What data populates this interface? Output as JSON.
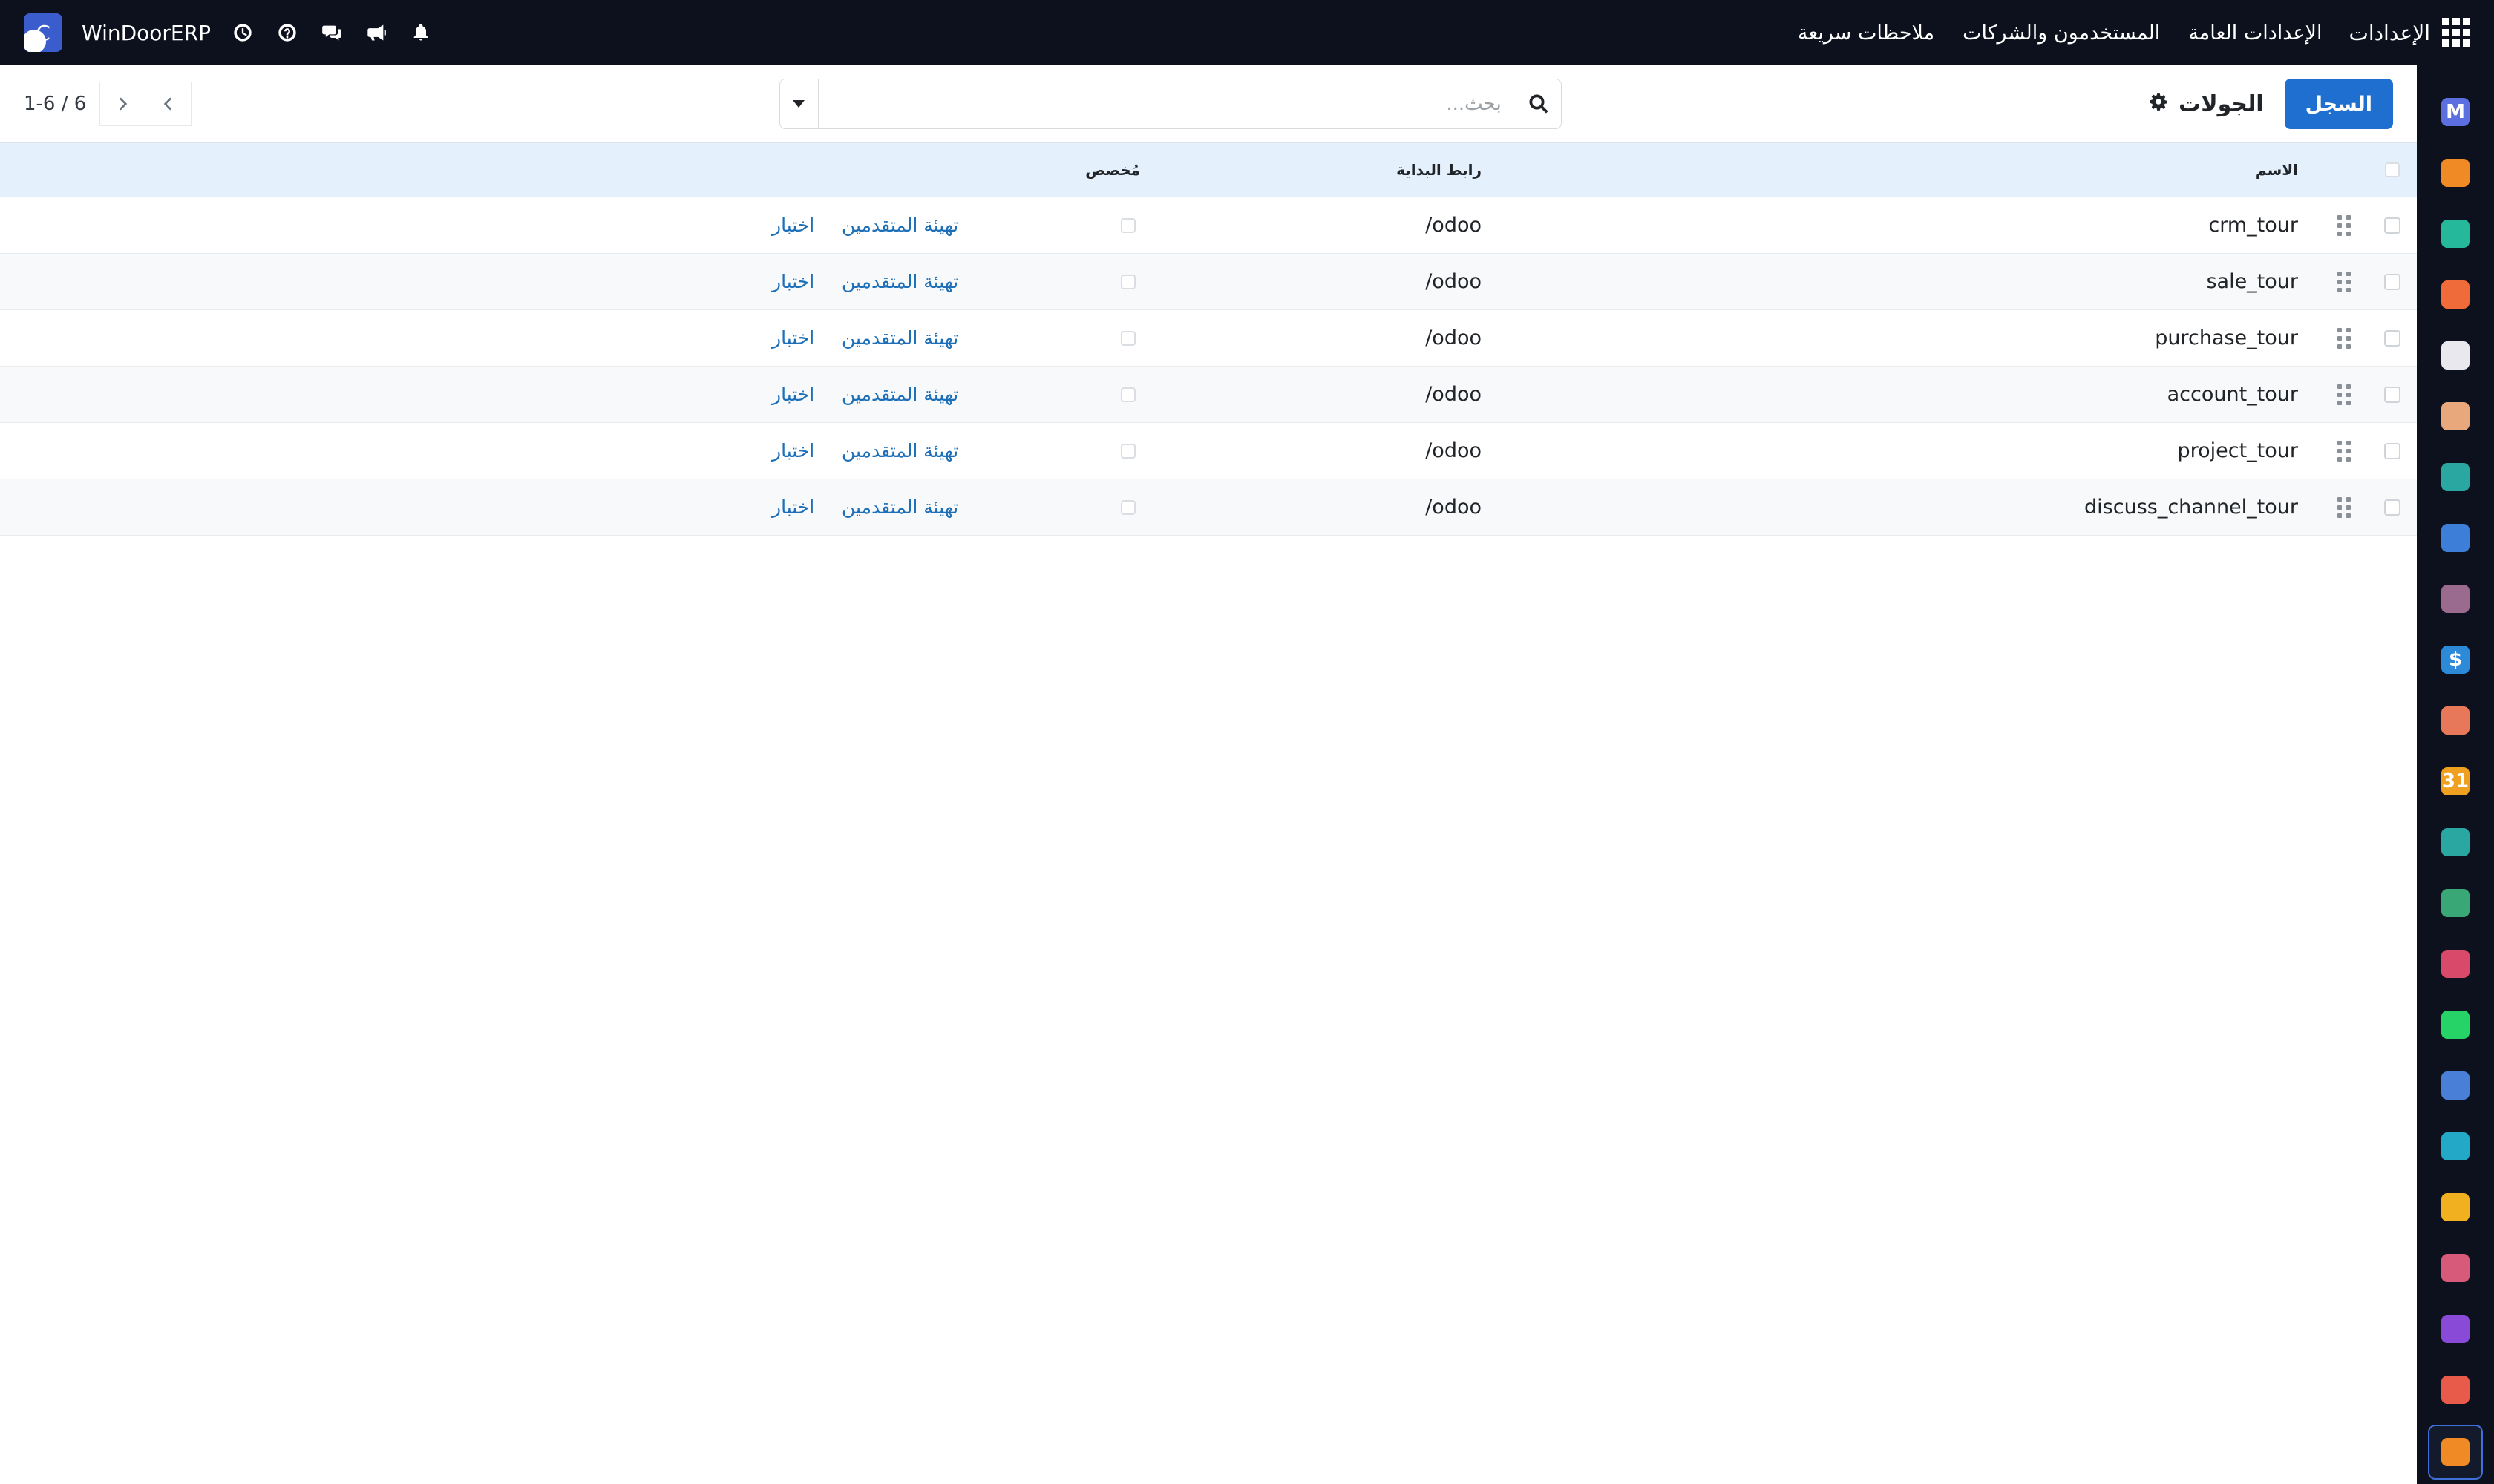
{
  "navbar": {
    "company": "WinDoorERP",
    "avatar_letter": "C",
    "brand": "الإعدادات",
    "menu": [
      "الإعدادات العامة",
      "المستخدمون والشركات",
      "ملاحظات سريعة"
    ],
    "icons": [
      "clock-icon",
      "help-icon",
      "chat-icon",
      "megaphone-icon",
      "bell-icon"
    ]
  },
  "control": {
    "new_label": "السجل",
    "title": "الجولات",
    "search_placeholder": "بحث...",
    "pager_value": "1-6",
    "pager_sep": " / ",
    "pager_total": "6"
  },
  "table": {
    "headers": {
      "name": "الاسم",
      "url": "رابط البداية",
      "custom": "مُخصص"
    },
    "rows": [
      {
        "name": "crm_tour",
        "url": "/odoo",
        "custom": false,
        "reset": "تهيئة المتقدمين",
        "test": "اختبار"
      },
      {
        "name": "sale_tour",
        "url": "/odoo",
        "custom": false,
        "reset": "تهيئة المتقدمين",
        "test": "اختبار"
      },
      {
        "name": "purchase_tour",
        "url": "/odoo",
        "custom": false,
        "reset": "تهيئة المتقدمين",
        "test": "اختبار"
      },
      {
        "name": "account_tour",
        "url": "/odoo",
        "custom": false,
        "reset": "تهيئة المتقدمين",
        "test": "اختبار"
      },
      {
        "name": "project_tour",
        "url": "/odoo",
        "custom": false,
        "reset": "تهيئة المتقدمين",
        "test": "اختبار"
      },
      {
        "name": "discuss_channel_tour",
        "url": "/odoo",
        "custom": false,
        "reset": "تهيئة المتقدمين",
        "test": "اختبار"
      }
    ]
  },
  "dock": {
    "apps": [
      {
        "icon": "m-app-icon",
        "color": "#5b6fe0",
        "glyph": "M"
      },
      {
        "icon": "chat-bubble-app-icon",
        "color": "#f08a24",
        "glyph": ""
      },
      {
        "icon": "leaf-app-icon",
        "color": "#26b89a",
        "glyph": ""
      },
      {
        "icon": "bar-chart-app-icon",
        "color": "#f06b3a",
        "glyph": ""
      },
      {
        "icon": "cube-app-icon",
        "color": "#e8e8ee",
        "glyph": ""
      },
      {
        "icon": "contacts-app-icon",
        "color": "#e8a87c",
        "glyph": ""
      },
      {
        "icon": "checkmark-app-icon",
        "color": "#2aa7a0",
        "glyph": ""
      },
      {
        "icon": "book-app-icon",
        "color": "#3d7fd8",
        "glyph": ""
      },
      {
        "icon": "box-app-icon",
        "color": "#9a6a8f",
        "glyph": ""
      },
      {
        "icon": "invoice-app-icon",
        "color": "#2d8ad8",
        "glyph": "$"
      },
      {
        "icon": "people-app-icon",
        "color": "#e8785a",
        "glyph": ""
      },
      {
        "icon": "calendar-app-icon",
        "color": "#f0a020",
        "glyph": "31"
      },
      {
        "icon": "pen-app-icon",
        "color": "#2aa7a0",
        "glyph": ""
      },
      {
        "icon": "badge-app-icon",
        "color": "#3aa777",
        "glyph": ""
      },
      {
        "icon": "dashboard-app-icon",
        "color": "#d94a6a",
        "glyph": ""
      },
      {
        "icon": "whatsapp-app-icon",
        "color": "#25d366",
        "glyph": ""
      },
      {
        "icon": "gauge-app-icon",
        "color": "#4a7fd8",
        "glyph": ""
      },
      {
        "icon": "wave-app-icon",
        "color": "#23a8c8",
        "glyph": ""
      },
      {
        "icon": "paper-plane-app-icon",
        "color": "#f0b020",
        "glyph": ""
      },
      {
        "icon": "stripes-app-icon",
        "color": "#d85a7a",
        "glyph": ""
      },
      {
        "icon": "hexagon-app-icon",
        "color": "#8a4ad8",
        "glyph": ""
      },
      {
        "icon": "pie-app-icon",
        "color": "#e85a4a",
        "glyph": ""
      },
      {
        "icon": "settings-app-icon",
        "color": "#f08a24",
        "glyph": ""
      }
    ]
  }
}
